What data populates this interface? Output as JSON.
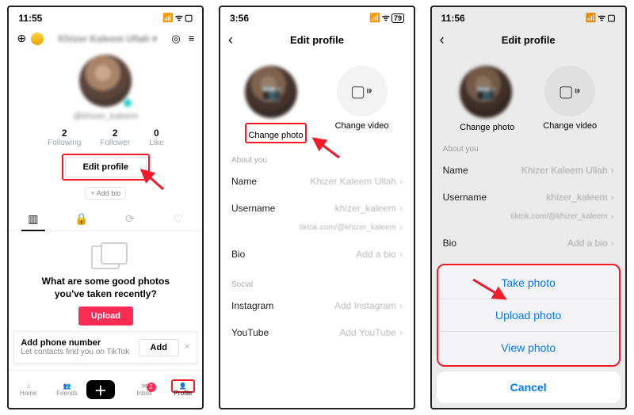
{
  "p1": {
    "time": "11:55",
    "signal": "⋮⋮ ᯤ ▢",
    "display_name": "Khizer Kaleem Ullah",
    "username_line": "@khizer_kaleem",
    "stats": {
      "following_n": "2",
      "following_l": "Following",
      "follower_n": "2",
      "follower_l": "Follower",
      "like_n": "0",
      "like_l": "Like"
    },
    "edit_profile": "Edit profile",
    "add_bio": "+ Add bio",
    "prompt_line1": "What are some good photos",
    "prompt_line2": "you've taken recently?",
    "upload": "Upload",
    "banner_title": "Add phone number",
    "banner_sub": "Let contacts find you on TikTok",
    "banner_add": "Add",
    "nav": {
      "home": "Home",
      "friends": "Friends",
      "inbox": "Inbox",
      "profile": "Profile",
      "inbox_badge": "2"
    }
  },
  "p2": {
    "time": "3:56",
    "battery": "79",
    "title": "Edit profile",
    "change_photo": "Change photo",
    "change_video": "Change video",
    "about": "About you",
    "name_k": "Name",
    "name_v": "Khizer Kaleem Ullah",
    "user_k": "Username",
    "user_v": "khizer_kaleem",
    "link": "tiktok.com/@khizer_kaleem",
    "bio_k": "Bio",
    "bio_v": "Add a bio",
    "social": "Social",
    "insta_k": "Instagram",
    "insta_v": "Add Instagram",
    "yt_k": "YouTube",
    "yt_v": "Add YouTube"
  },
  "p3": {
    "time": "11:56",
    "title": "Edit profile",
    "change_photo": "Change photo",
    "change_video": "Change video",
    "about": "About you",
    "name_k": "Name",
    "name_v": "Khizer Kaleem Ullah",
    "user_k": "Username",
    "user_v": "khizer_kaleem",
    "link": "tiktok.com/@khizer_kaleem",
    "bio_k": "Bio",
    "bio_v": "Add a bio",
    "sheet": {
      "take": "Take photo",
      "upload": "Upload photo",
      "view": "View photo",
      "cancel": "Cancel"
    }
  }
}
